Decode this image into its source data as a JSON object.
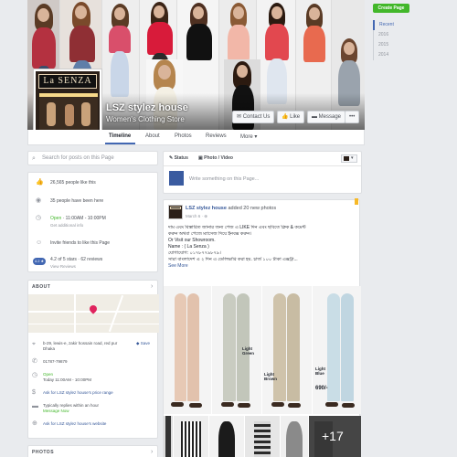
{
  "cover": {
    "page_name": "LSZ stylez house",
    "category": "Women's Clothing Store",
    "logo_text": "La SENZA",
    "buttons": {
      "contact": "Contact Us",
      "like": "Like",
      "message": "Message",
      "more": "•••"
    }
  },
  "tabs": [
    "Timeline",
    "About",
    "Photos",
    "Reviews",
    "More ▾"
  ],
  "right_rail": {
    "create_page": "Create Page",
    "years": [
      "Recent",
      "2016",
      "2015",
      "2014"
    ]
  },
  "search": {
    "placeholder": "Search for posts on this Page"
  },
  "stats": {
    "likes": "26,565 people like this",
    "been": "35 people have been here",
    "hours": {
      "status": "Open",
      "time": " · 11:00AM - 10:00PM",
      "sub": "Get additional info"
    },
    "invite": "Invite friends to like this Page",
    "rating": {
      "badge": "4.2 ★",
      "text": "4.2 of 5 stars · 62 reviews",
      "sub": "View Reviews"
    }
  },
  "about": {
    "title": "ABOUT",
    "address": "b-29, lewis-e, zakir hossain road, red pur Dhaka",
    "save": "Save",
    "phone": "01787-79879",
    "hours_open": "Open",
    "hours_today": "Today 11:00AM - 10:00PM",
    "price_link": "Ask for LSZ stylez house's price range",
    "response": "Typically replies within an hour",
    "message_now": "Message Now",
    "website_link": "Ask for LSZ stylez house's website"
  },
  "photos_section": {
    "title": "PHOTOS"
  },
  "status_box": {
    "tab_status": "Status",
    "tab_photo": "Photo / Video",
    "placeholder": "Write something on this Page..."
  },
  "post": {
    "author": "LSZ stylez house",
    "action": " added 20 new photos",
    "time": "March 6 · ",
    "lines": [
      "দাম এবং বিস্তারিত জানার জন্য পেজ এ LIKE দিন এবং ছবিতে ক্লিক & কমেন্ট",
      "করুন অথবা পেজে ম্যাসেজ দিয়ে ইনবক্স করুন।",
      "Or Visit our Showroom.",
      "Name : ( La Senza )",
      "যোগাযোগ: ০১৭৮৭৭৯৮৭৯।",
      "সারা বাংলাদেশ এ ২ দিন এ ডেলিভারি করা হয়. চার্জ ১০০ টাকা এক্সট্রা..."
    ],
    "see_more": "See More",
    "labels": {
      "light_green": "Light\nGreen",
      "light_brown": "Light\nBrown",
      "light_blue": "Light\nBlue",
      "price": "690/-"
    },
    "more_count": "+17"
  },
  "colors": {
    "accent": "#4267b2",
    "create_btn": "#42b72a",
    "bg": "#e9ebee"
  }
}
